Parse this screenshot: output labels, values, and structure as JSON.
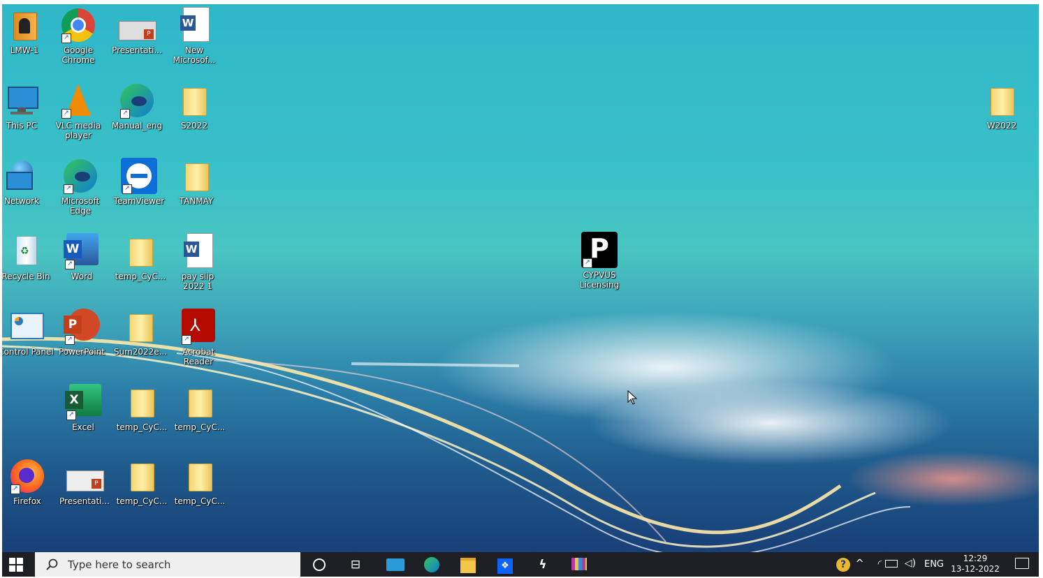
{
  "desktop": {
    "icons": [
      {
        "label": "LMW-1",
        "kind": "folder-person"
      },
      {
        "label": "Google Chrome",
        "kind": "chrome"
      },
      {
        "label": "Presentati...",
        "kind": "pptx-file"
      },
      {
        "label": "New Microsof...",
        "kind": "word-file"
      },
      {
        "label": "This PC",
        "kind": "pc"
      },
      {
        "label": "VLC media player",
        "kind": "vlc"
      },
      {
        "label": "Manual_eng",
        "kind": "edge"
      },
      {
        "label": "S2022",
        "kind": "folder"
      },
      {
        "label": "Network",
        "kind": "network"
      },
      {
        "label": "Microsoft Edge",
        "kind": "edge"
      },
      {
        "label": "TeamViewer",
        "kind": "teamviewer"
      },
      {
        "label": "TANMAY",
        "kind": "folder"
      },
      {
        "label": "Recycle Bin",
        "kind": "recycle"
      },
      {
        "label": "Word",
        "kind": "word"
      },
      {
        "label": "temp_CyC...",
        "kind": "folder"
      },
      {
        "label": "pay slip 2022 1",
        "kind": "word-file"
      },
      {
        "label": "Control Panel",
        "kind": "control"
      },
      {
        "label": "PowerPoint",
        "kind": "powerpoint"
      },
      {
        "label": "Sum2022e...",
        "kind": "folder"
      },
      {
        "label": "Acrobat Reader",
        "kind": "acrobat"
      },
      {
        "label": "Excel",
        "kind": "excel"
      },
      {
        "label": "temp_CyC...",
        "kind": "folder"
      },
      {
        "label": "temp_CyC...",
        "kind": "folder"
      },
      {
        "label": "Firefox",
        "kind": "firefox"
      },
      {
        "label": "Presentati...",
        "kind": "pptx-file"
      },
      {
        "label": "temp_CyC...",
        "kind": "folder"
      },
      {
        "label": "temp_CyC...",
        "kind": "folder"
      },
      {
        "label": "CYPVUS Licensing",
        "kind": "cypvus"
      },
      {
        "label": "W2022",
        "kind": "folder"
      }
    ]
  },
  "taskbar": {
    "search_placeholder": "Type here to search",
    "pinned": [
      "cortana-icon",
      "task-view-icon",
      "mail-icon",
      "edge-icon",
      "file-explorer-icon",
      "dropbox-icon",
      "app-s-icon",
      "winrar-icon"
    ],
    "tray": {
      "language": "ENG",
      "time": "12:29",
      "date": "13-12-2022"
    }
  },
  "colors": {
    "taskbar_bg": "#1d1f25",
    "desktop_top": "#2fb7c9",
    "desktop_bottom": "#183f78"
  }
}
